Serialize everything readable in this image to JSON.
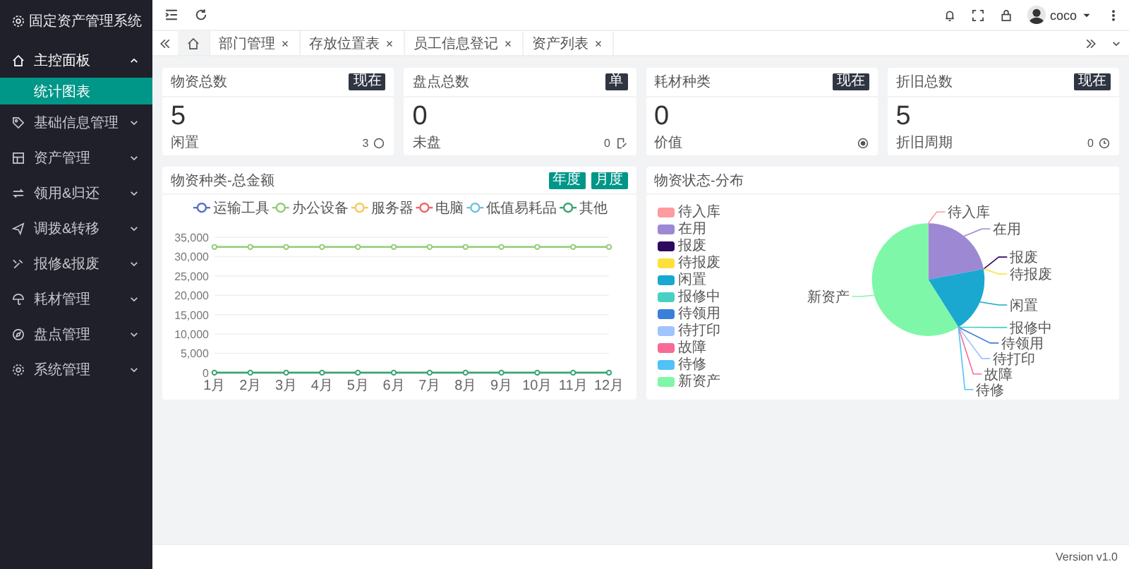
{
  "app": {
    "title": "固定资产管理系统"
  },
  "sidebar": {
    "items": [
      {
        "label": "主控面板",
        "expanded": true,
        "children": [
          {
            "label": "统计图表",
            "selected": true
          }
        ]
      },
      {
        "label": "基础信息管理",
        "expanded": false
      },
      {
        "label": "资产管理",
        "expanded": false
      },
      {
        "label": "领用&归还",
        "expanded": false
      },
      {
        "label": "调拨&转移",
        "expanded": false
      },
      {
        "label": "报修&报废",
        "expanded": false
      },
      {
        "label": "耗材管理",
        "expanded": false
      },
      {
        "label": "盘点管理",
        "expanded": false
      },
      {
        "label": "系统管理",
        "expanded": false
      }
    ]
  },
  "header": {
    "user": "coco"
  },
  "tabs": [
    {
      "kind": "home",
      "selected": true
    },
    {
      "kind": "page",
      "label": "部门管理",
      "selected": false
    },
    {
      "kind": "page",
      "label": "存放位置表",
      "selected": false
    },
    {
      "kind": "page",
      "label": "员工信息登记",
      "selected": false
    },
    {
      "kind": "page",
      "label": "资产列表",
      "selected": false
    }
  ],
  "stat_cards": [
    {
      "title": "物资总数",
      "badge": "现在",
      "value": "5",
      "label": "闲置",
      "count": "3"
    },
    {
      "title": "盘点总数",
      "badge": "单",
      "value": "0",
      "label": "未盘",
      "count": "0"
    },
    {
      "title": "耗材种类",
      "badge": "现在",
      "value": "0",
      "label": "价值"
    },
    {
      "title": "折旧总数",
      "badge": "现在",
      "value": "5",
      "label": "折旧周期",
      "count": "0"
    }
  ],
  "line_card": {
    "title": "物资种类-总金额",
    "buttons": [
      "年度",
      "月度"
    ],
    "chart_data": {
      "type": "line",
      "categories": [
        "1月",
        "2月",
        "3月",
        "4月",
        "5月",
        "6月",
        "7月",
        "8月",
        "9月",
        "10月",
        "11月",
        "12月"
      ],
      "ylim": [
        0,
        35000
      ],
      "grid": true,
      "legend": true,
      "yticks": [
        0,
        {
          "value": 5000,
          "label": "5,000"
        },
        {
          "value": 10000,
          "label": "10,000"
        },
        {
          "value": 15000,
          "label": "15,000"
        },
        {
          "value": 20000,
          "label": "20,000"
        },
        {
          "value": 25000,
          "label": "25,000"
        },
        {
          "value": 30000,
          "label": "30,000"
        },
        {
          "value": 35000,
          "label": "35,000"
        }
      ],
      "series": [
        {
          "name": "运输工具",
          "color": "#5470c6",
          "marker": "circle",
          "values": [
            null,
            null,
            null,
            null,
            null,
            null,
            null,
            null,
            null,
            null,
            null,
            null
          ]
        },
        {
          "name": "办公设备",
          "color": "#91cc75",
          "marker": "circle",
          "values": [
            32500,
            32500,
            32500,
            32500,
            32500,
            32500,
            32500,
            32500,
            32500,
            32500,
            32500,
            32500
          ]
        },
        {
          "name": "服务器",
          "color": "#fac858",
          "marker": "circle",
          "values": [
            null,
            null,
            null,
            null,
            null,
            null,
            null,
            null,
            null,
            null,
            null,
            null
          ]
        },
        {
          "name": "电脑",
          "color": "#ee6666",
          "marker": "circle",
          "values": [
            null,
            null,
            null,
            null,
            null,
            null,
            null,
            null,
            null,
            null,
            null,
            null
          ]
        },
        {
          "name": "低值易耗品",
          "color": "#73c0de",
          "marker": "circle",
          "values": [
            null,
            null,
            null,
            null,
            null,
            null,
            null,
            null,
            null,
            null,
            null,
            null
          ]
        },
        {
          "name": "其他",
          "color": "#3ba272",
          "marker": "circle",
          "values": [
            0,
            0,
            0,
            0,
            0,
            0,
            0,
            0,
            0,
            0,
            0,
            0
          ]
        }
      ]
    }
  },
  "pie_card": {
    "title": "物资状态-分布",
    "legend": [
      {
        "label": "待入库",
        "color": "#ff9a9e"
      },
      {
        "label": "在用",
        "color": "#9d88d3"
      },
      {
        "label": "报废",
        "color": "#2d0a5e"
      },
      {
        "label": "待报废",
        "color": "#fde03a"
      },
      {
        "label": "闲置",
        "color": "#1aa8d0"
      },
      {
        "label": "报修中",
        "color": "#46d1c4"
      },
      {
        "label": "待领用",
        "color": "#3a7fd9"
      },
      {
        "label": "待打印",
        "color": "#a0c4ff"
      },
      {
        "label": "故障",
        "color": "#f86b97"
      },
      {
        "label": "待修",
        "color": "#4fc3f7"
      },
      {
        "label": "新资产",
        "color": "#7ff7a8"
      }
    ],
    "slice_labels": [
      "待入库",
      "在用",
      "报废",
      "待报废",
      "闲置",
      "报修中",
      "待领用",
      "待打印",
      "故障",
      "待修",
      "新资产"
    ]
  },
  "footer": {
    "version": "Version v1.0"
  }
}
